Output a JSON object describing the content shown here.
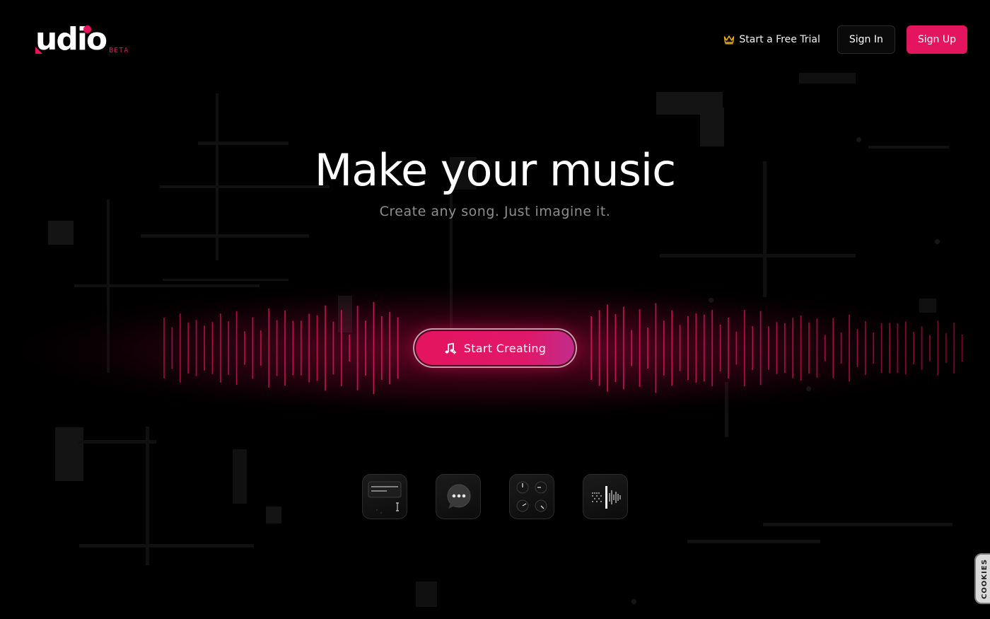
{
  "brand": {
    "name": "udio",
    "badge": "BETA",
    "accent_color": "#e4145f"
  },
  "nav": {
    "trial_label": "Start a Free Trial",
    "trial_icon": "crown-icon",
    "signin_label": "Sign In",
    "signup_label": "Sign Up"
  },
  "hero": {
    "title": "Make your music",
    "subtitle": "Create any song. Just imagine it.",
    "cta_label": "Start Creating",
    "cta_icon": "music-note-plus-icon"
  },
  "features": [
    {
      "icon": "text-prompt-icon"
    },
    {
      "icon": "chat-bubble-icon"
    },
    {
      "icon": "control-knobs-icon"
    },
    {
      "icon": "waveform-edit-icon"
    }
  ],
  "cookies": {
    "label": "COOKIES"
  }
}
